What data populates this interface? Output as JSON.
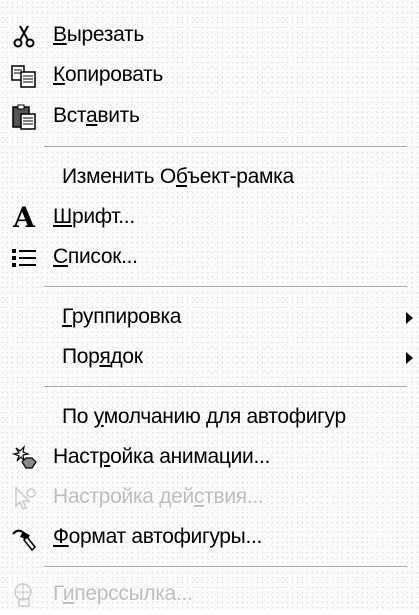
{
  "menu": {
    "cut": {
      "pre": "",
      "ul": "В",
      "post": "ырезать",
      "icon": "scissors-icon"
    },
    "copy": {
      "pre": "",
      "ul": "К",
      "post": "опировать",
      "icon": "copy-icon"
    },
    "paste": {
      "pre": "Вст",
      "ul": "а",
      "post": "вить",
      "icon": "paste-icon"
    },
    "edit_object": {
      "pre": "Изменить О",
      "ul": "б",
      "post": "ъект-рамка"
    },
    "font": {
      "pre": "",
      "ul": "Ш",
      "post": "рифт...",
      "icon": "font-icon"
    },
    "list": {
      "pre": "",
      "ul": "С",
      "post": "писок...",
      "icon": "list-icon"
    },
    "grouping": {
      "pre": "",
      "ul": "Г",
      "post": "руппировка"
    },
    "order": {
      "pre": "Пор",
      "ul": "я",
      "post": "док"
    },
    "default_autoshape": {
      "pre": "По ",
      "ul": "у",
      "post": "молчанию для автофигур"
    },
    "custom_animation": {
      "pre": "Наст",
      "ul": "р",
      "post": "ойка анимации...",
      "icon": "animation-icon"
    },
    "action_settings": {
      "pre": "Настройка дей",
      "ul": "с",
      "post": "твия...",
      "icon": "action-icon"
    },
    "format_autoshape": {
      "pre": "",
      "ul": "Ф",
      "post": "ормат автофигуры...",
      "icon": "format-icon"
    },
    "hyperlink": {
      "pre": "Г",
      "ul": "и",
      "post": "перссылка...",
      "icon": "hyperlink-icon"
    }
  },
  "colors": {
    "disabled_text": "#bdbdbd",
    "separator": "#a8a8a8"
  }
}
